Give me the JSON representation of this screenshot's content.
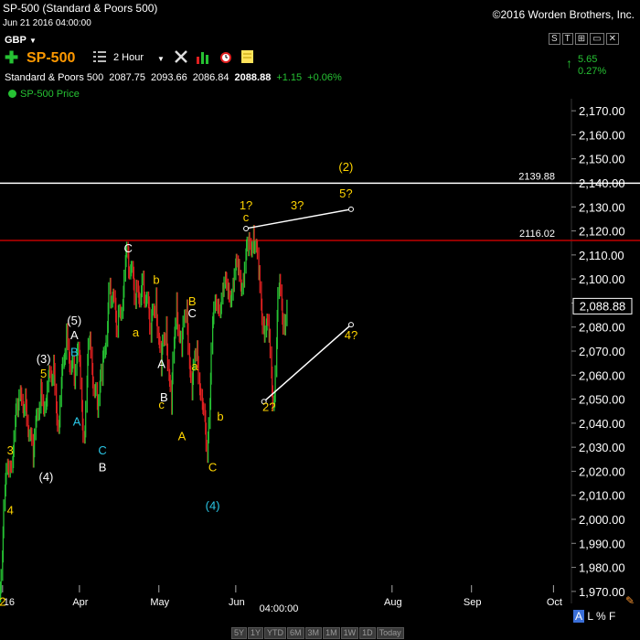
{
  "header": {
    "title": "SP-500 (Standard & Poors 500)",
    "copyright": "©2016 Worden Brothers, Inc.",
    "datetime": "Jun 21 2016 04:00:00"
  },
  "toolbar": {
    "currency": "GBP",
    "symbol": "SP-500",
    "timeframe": "2 Hour",
    "icons": [
      "plus-icon",
      "list-icon",
      "tools-icon",
      "bar-chart-icon",
      "alarm-clock-icon",
      "note-icon"
    ],
    "window_controls": [
      "S",
      "T",
      "",
      ""
    ]
  },
  "quote": {
    "name": "Standard & Poors 500",
    "open": "2087.75",
    "high": "2093.66",
    "low": "2086.84",
    "last": "2088.88",
    "change": "+1.15",
    "change_pct": "+0.06%"
  },
  "change_box": {
    "abs": "5.65",
    "pct": "0.27%"
  },
  "legend": {
    "label": "SP-500 Price"
  },
  "bottom": {
    "ranges": [
      "5Y",
      "1Y",
      "YTD",
      "6M",
      "3M",
      "1M",
      "1W",
      "1D",
      "Today"
    ],
    "scale_toggles": [
      "A",
      "L",
      "%",
      "F"
    ],
    "cursor_time": "04:00:00"
  },
  "colors": {
    "price_up": "#26c233",
    "price_down": "#e02020",
    "label_yellow": "#ffd400",
    "label_white": "#ffffff",
    "label_cyan": "#2ac6e6",
    "resistance_white": "#ffffff",
    "resistance_red": "#c00000"
  },
  "chart_data": {
    "type": "line",
    "title": "SP-500 Price",
    "ylim": [
      1965,
      2175
    ],
    "y_ticks": [
      1970,
      1980,
      1990,
      2000,
      2010,
      2020,
      2030,
      2040,
      2050,
      2060,
      2070,
      2080,
      2090,
      2100,
      2110,
      2120,
      2130,
      2140,
      2150,
      2160,
      2170
    ],
    "y_tick_labels": [
      "1,970.00",
      "1,980.00",
      "1,990.00",
      "2,000.00",
      "2,010.00",
      "2,020.00",
      "2,030.00",
      "2,040.00",
      "2,050.00",
      "2,060.00",
      "2,070.00",
      "2,080.00",
      "2,090.00",
      "2,100.00",
      "2,110.00",
      "2,120.00",
      "2,130.00",
      "2,140.00",
      "2,150.00",
      "2,160.00",
      "2,170.00"
    ],
    "x_tick_labels": [
      "16",
      "Apr",
      "May",
      "Jun",
      "Aug",
      "Sep",
      "Oct"
    ],
    "x_tick_dates": [
      "2016-03-02",
      "2016-04-01",
      "2016-05-02",
      "2016-06-01",
      "2016-08-01",
      "2016-09-01",
      "2016-10-03"
    ],
    "last_price": 2088.88,
    "last_price_label": "2,088.88",
    "series": [
      {
        "x": [
          "2016-03-01",
          "2016-03-03",
          "2016-03-05",
          "2016-03-08",
          "2016-03-11",
          "2016-03-14",
          "2016-03-17",
          "2016-03-19",
          "2016-03-22",
          "2016-03-24",
          "2016-03-27",
          "2016-03-30",
          "2016-04-01",
          "2016-04-03",
          "2016-04-05",
          "2016-04-08",
          "2016-04-10",
          "2016-04-13",
          "2016-04-16",
          "2016-04-20",
          "2016-04-23",
          "2016-04-26",
          "2016-04-29",
          "2016-05-01",
          "2016-05-03",
          "2016-05-05",
          "2016-05-07",
          "2016-05-09",
          "2016-05-11",
          "2016-05-13",
          "2016-05-15",
          "2016-05-17",
          "2016-05-19",
          "2016-05-21",
          "2016-05-23",
          "2016-05-25",
          "2016-05-27",
          "2016-05-29",
          "2016-05-31",
          "2016-06-02",
          "2016-06-04",
          "2016-06-06",
          "2016-06-08",
          "2016-06-10",
          "2016-06-12",
          "2016-06-14",
          "2016-06-16",
          "2016-06-18",
          "2016-06-20",
          "2016-06-21"
        ],
        "values": [
          1968,
          2012,
          2022,
          2045,
          2052,
          2024,
          2056,
          2048,
          2066,
          2038,
          2079,
          2058,
          2068,
          2034,
          2074,
          2048,
          2058,
          2098,
          2078,
          2111,
          2090,
          2101,
          2076,
          2094,
          2062,
          2082,
          2046,
          2092,
          2070,
          2089,
          2052,
          2072,
          2048,
          2026,
          2082,
          2088,
          2096,
          2094,
          2098,
          2104,
          2100,
          2112,
          2120,
          2102,
          2082,
          2076,
          2049,
          2096,
          2083,
          2088.88
        ]
      }
    ],
    "horizontal_lines": [
      {
        "value": 2139.88,
        "label": "2139.88",
        "color": "#ffffff"
      },
      {
        "value": 2116.02,
        "label": "2116.02",
        "color": "#c00000"
      }
    ],
    "projection_lines": [
      {
        "from": {
          "x": "2016-06-05",
          "y": 2121
        },
        "to": {
          "x": "2016-07-16",
          "y": 2129
        }
      },
      {
        "from": {
          "x": "2016-06-12",
          "y": 2049
        },
        "to": {
          "x": "2016-07-16",
          "y": 2081
        }
      }
    ],
    "wave_labels": [
      {
        "text": "2",
        "x": "2016-03-02",
        "y": 1964,
        "color": "label_yellow"
      },
      {
        "text": "4",
        "x": "2016-03-05",
        "y": 2002,
        "color": "label_yellow"
      },
      {
        "text": "3",
        "x": "2016-03-05",
        "y": 2027,
        "color": "label_yellow"
      },
      {
        "text": "(4)",
        "x": "2016-03-19",
        "y": 2016,
        "color": "label_white"
      },
      {
        "text": "(3)",
        "x": "2016-03-18",
        "y": 2065,
        "color": "label_white"
      },
      {
        "text": "5",
        "x": "2016-03-18",
        "y": 2059,
        "color": "label_yellow"
      },
      {
        "text": "(5)",
        "x": "2016-03-30",
        "y": 2081,
        "color": "label_white"
      },
      {
        "text": "A",
        "x": "2016-03-30",
        "y": 2075,
        "color": "label_white"
      },
      {
        "text": "B",
        "x": "2016-03-30",
        "y": 2068,
        "color": "label_cyan"
      },
      {
        "text": "A",
        "x": "2016-03-31",
        "y": 2039,
        "color": "label_cyan"
      },
      {
        "text": "C",
        "x": "2016-04-10",
        "y": 2027,
        "color": "label_cyan"
      },
      {
        "text": "B",
        "x": "2016-04-10",
        "y": 2020,
        "color": "label_white"
      },
      {
        "text": "C",
        "x": "2016-04-20",
        "y": 2111,
        "color": "label_white"
      },
      {
        "text": "a",
        "x": "2016-04-23",
        "y": 2076,
        "color": "label_yellow"
      },
      {
        "text": "b",
        "x": "2016-05-01",
        "y": 2098,
        "color": "label_yellow"
      },
      {
        "text": "A",
        "x": "2016-05-03",
        "y": 2063,
        "color": "label_white"
      },
      {
        "text": "B",
        "x": "2016-05-04",
        "y": 2049,
        "color": "label_white"
      },
      {
        "text": "c",
        "x": "2016-05-03",
        "y": 2046,
        "color": "label_yellow"
      },
      {
        "text": "B",
        "x": "2016-05-15",
        "y": 2089,
        "color": "label_yellow"
      },
      {
        "text": "C",
        "x": "2016-05-15",
        "y": 2084,
        "color": "label_white"
      },
      {
        "text": "a",
        "x": "2016-05-16",
        "y": 2062,
        "color": "label_yellow"
      },
      {
        "text": "A",
        "x": "2016-05-11",
        "y": 2033,
        "color": "label_yellow"
      },
      {
        "text": "b",
        "x": "2016-05-26",
        "y": 2041,
        "color": "label_yellow"
      },
      {
        "text": "C",
        "x": "2016-05-23",
        "y": 2020,
        "color": "label_yellow"
      },
      {
        "text": "(4)",
        "x": "2016-05-23",
        "y": 2004,
        "color": "label_cyan"
      },
      {
        "text": "1?",
        "x": "2016-06-05",
        "y": 2129,
        "color": "label_yellow"
      },
      {
        "text": "c",
        "x": "2016-06-05",
        "y": 2124,
        "color": "label_yellow"
      },
      {
        "text": "3?",
        "x": "2016-06-25",
        "y": 2129,
        "color": "label_yellow"
      },
      {
        "text": "5?",
        "x": "2016-07-14",
        "y": 2134,
        "color": "label_yellow"
      },
      {
        "text": "(2)",
        "x": "2016-07-14",
        "y": 2145,
        "color": "label_yellow"
      },
      {
        "text": "4?",
        "x": "2016-07-16",
        "y": 2075,
        "color": "label_yellow"
      },
      {
        "text": "2?",
        "x": "2016-06-14",
        "y": 2045,
        "color": "label_yellow"
      }
    ]
  }
}
